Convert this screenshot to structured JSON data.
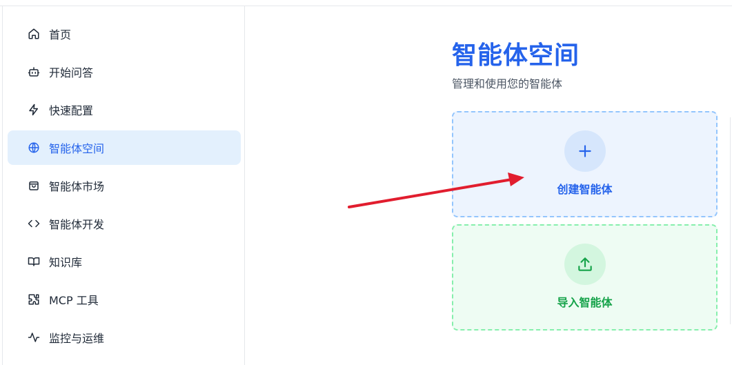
{
  "sidebar": {
    "items": [
      {
        "label": "首页",
        "icon": "home-icon",
        "active": false
      },
      {
        "label": "开始问答",
        "icon": "bot-icon",
        "active": false
      },
      {
        "label": "快速配置",
        "icon": "zap-icon",
        "active": false
      },
      {
        "label": "智能体空间",
        "icon": "globe-icon",
        "active": true
      },
      {
        "label": "智能体市场",
        "icon": "shopping-bag-icon",
        "active": false
      },
      {
        "label": "智能体开发",
        "icon": "code-icon",
        "active": false
      },
      {
        "label": "知识库",
        "icon": "book-open-icon",
        "active": false
      },
      {
        "label": "MCP 工具",
        "icon": "puzzle-icon",
        "active": false
      },
      {
        "label": "监控与运维",
        "icon": "activity-icon",
        "active": false
      }
    ]
  },
  "main": {
    "title": "智能体空间",
    "subtitle": "管理和使用您的智能体",
    "create_card": {
      "label": "创建智能体",
      "icon": "plus-icon"
    },
    "import_card": {
      "label": "导入智能体",
      "icon": "upload-icon"
    }
  },
  "colors": {
    "accent": "#2563eb",
    "active_bg": "#e3f0fd",
    "success": "#16a34a",
    "annotation_arrow": "#e11d2e"
  }
}
